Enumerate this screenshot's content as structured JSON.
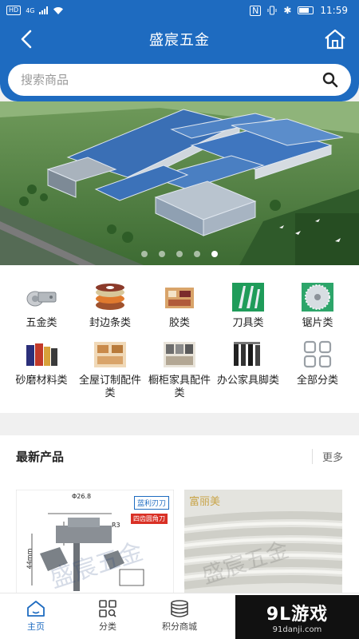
{
  "status_bar": {
    "network": "HD",
    "signal": "4G",
    "time": "11:59"
  },
  "header": {
    "title": "盛宸五金"
  },
  "search": {
    "placeholder": "搜索商品"
  },
  "banner": {
    "slide_count": 5,
    "active_slide": 5
  },
  "categories": [
    {
      "label": "五金类",
      "icon": "hinge-icon"
    },
    {
      "label": "封边条类",
      "icon": "edge-band-rolls-icon"
    },
    {
      "label": "胶类",
      "icon": "glue-icon"
    },
    {
      "label": "刀具类",
      "icon": "cutter-icon"
    },
    {
      "label": "锯片类",
      "icon": "saw-blade-icon"
    },
    {
      "label": "砂磨材料类",
      "icon": "abrasive-icon"
    },
    {
      "label": "全屋订制配件类",
      "icon": "whole-house-parts-icon"
    },
    {
      "label": "橱柜家具配件类",
      "icon": "cabinet-parts-icon"
    },
    {
      "label": "办公家具脚类",
      "icon": "office-furniture-legs-icon"
    },
    {
      "label": "全部分类",
      "icon": "all-categories-grid-icon"
    }
  ],
  "latest": {
    "title": "最新产品",
    "more_label": "更多",
    "product1": {
      "badge": "蓝利刃刀",
      "subtitle": "四齿圆角刀",
      "dim_top": "Φ26.8",
      "dim_r": "R3",
      "dim_side": "44mm",
      "watermark": "盛宸五金"
    },
    "product2": {
      "brand": "富丽美",
      "watermark": "盛宸五金"
    }
  },
  "tabbar": [
    {
      "label": "主页",
      "icon": "home-tab-icon",
      "active": true
    },
    {
      "label": "分类",
      "icon": "category-tab-icon",
      "active": false
    },
    {
      "label": "积分商城",
      "icon": "points-mall-tab-icon",
      "active": false
    }
  ],
  "watermark": {
    "brand": "9L游戏",
    "site": "91danji.com"
  },
  "colors": {
    "primary": "#1e6bc0",
    "background": "#f0f0f0"
  }
}
